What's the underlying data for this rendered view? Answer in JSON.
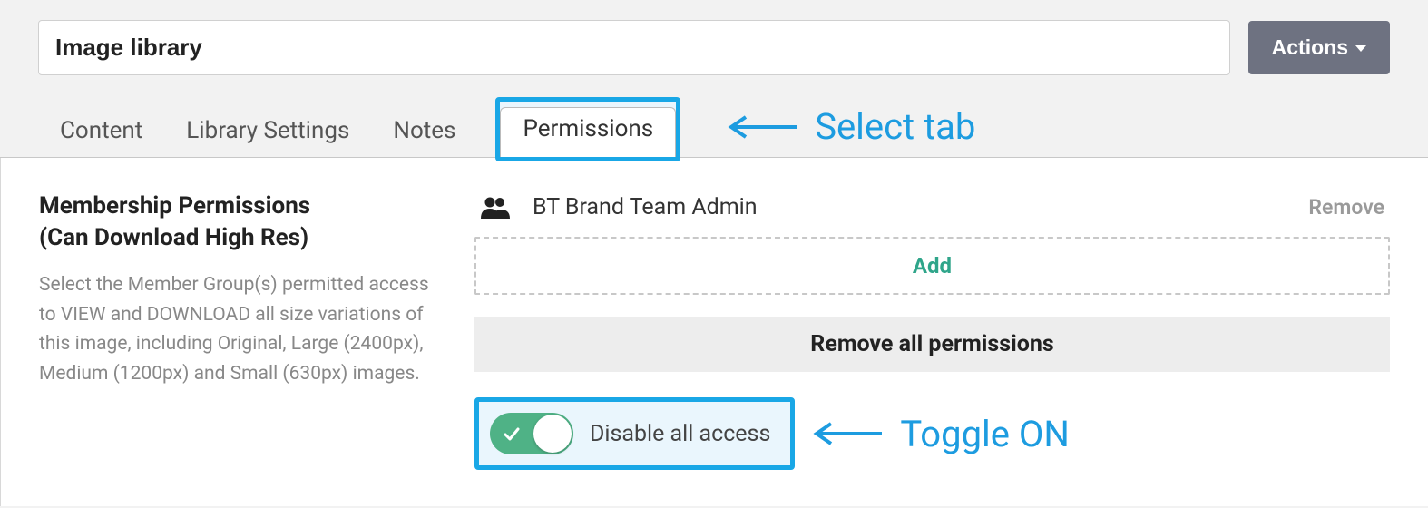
{
  "header": {
    "title": "Image library",
    "actions_label": "Actions"
  },
  "tabs": {
    "items": [
      {
        "label": "Content"
      },
      {
        "label": "Library Settings"
      },
      {
        "label": "Notes"
      },
      {
        "label": "Permissions"
      }
    ],
    "selected_index": 3
  },
  "annotations": {
    "select_tab": "Select tab",
    "toggle_on": "Toggle ON"
  },
  "permissions": {
    "title_line1": "Membership Permissions",
    "title_line2": "(Can Download High Res)",
    "description": "Select the Member Group(s) permitted access to VIEW and DOWNLOAD all size variations of this image, including Original, Large (2400px), Medium (1200px) and Small (630px) images.",
    "group_name": "BT Brand Team Admin",
    "remove_label": "Remove",
    "add_label": "Add",
    "remove_all_label": "Remove all permissions",
    "disable_all_label": "Disable all access",
    "toggle_state": "on"
  },
  "colors": {
    "highlight": "#19a7e6",
    "highlight_bg": "#eaf6fd",
    "toggle_green": "#4fb286",
    "add_green": "#2fa58a",
    "actions_bg": "#6e7281"
  }
}
